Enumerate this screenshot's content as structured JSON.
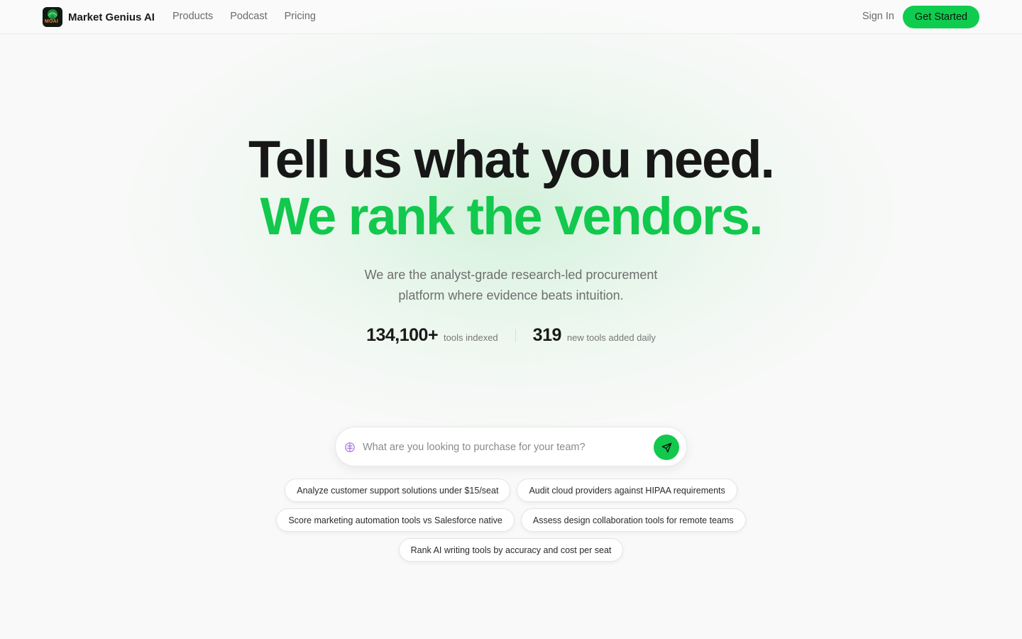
{
  "header": {
    "brand_name": "Market Genius AI",
    "logo_text": "MGAI",
    "nav": [
      "Products",
      "Podcast",
      "Pricing"
    ],
    "sign_in": "Sign In",
    "get_started": "Get Started"
  },
  "hero": {
    "line1": "Tell us what you need.",
    "line2": "We rank the vendors.",
    "subtitle": "We are the analyst-grade research-led procurement platform where evidence beats intuition."
  },
  "stats": [
    {
      "value": "134,100+",
      "label": "tools indexed"
    },
    {
      "value": "319",
      "label": "new tools added daily"
    }
  ],
  "search": {
    "placeholder": "What are you looking to purchase for your team?",
    "leading_icon": "brain-icon",
    "send_icon": "send-icon"
  },
  "suggestions": [
    "Analyze customer support solutions under $15/seat",
    "Audit cloud providers against HIPAA requirements",
    "Score marketing automation tools vs Salesforce native",
    "Assess design collaboration tools for remote teams",
    "Rank AI writing tools by accuracy and cost per seat"
  ],
  "colors": {
    "accent": "#12c84d",
    "cta": "#0fcc4f",
    "text": "#171717",
    "muted": "#6e6e6e",
    "background": "#f8f9f8"
  }
}
